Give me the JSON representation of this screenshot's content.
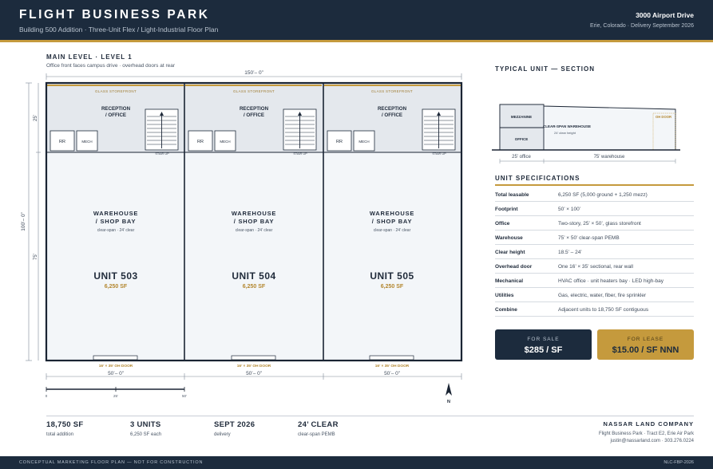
{
  "header": {
    "title": "FLIGHT BUSINESS PARK",
    "subtitle": "Building 500 Addition · Three-Unit Flex / Light-Industrial Floor Plan",
    "address": "3000 Airport Drive",
    "location": "Erie, Colorado · Delivery September 2026"
  },
  "plan": {
    "title": "MAIN LEVEL · LEVEL 1",
    "subtitle": "Office front faces campus drive · overhead doors at rear",
    "overall_width": "150’– 0”",
    "overall_depth": "100’– 0”",
    "office_depth": "25’",
    "warehouse_depth": "75’",
    "units": [
      {
        "storefront": "GLASS STOREFRONT",
        "reception": [
          "RECEPTION",
          "/ OFFICE"
        ],
        "rr": "RR",
        "mech": "MECH",
        "stair": "STAIR UP",
        "warehouse": [
          "WAREHOUSE",
          "/ SHOP BAY"
        ],
        "clear": "clear-span · 24’ clear",
        "unit_name": "UNIT 503",
        "unit_sf": "6,250 SF",
        "door": "16’ × 35’ OH DOOR",
        "width": "50’– 0”"
      },
      {
        "storefront": "GLASS STOREFRONT",
        "reception": [
          "RECEPTION",
          "/ OFFICE"
        ],
        "rr": "RR",
        "mech": "MECH",
        "stair": "STAIR UP",
        "warehouse": [
          "WAREHOUSE",
          "/ SHOP BAY"
        ],
        "clear": "clear-span · 24’ clear",
        "unit_name": "UNIT 504",
        "unit_sf": "6,250 SF",
        "door": "16’ × 35’ OH DOOR",
        "width": "50’– 0”"
      },
      {
        "storefront": "GLASS STOREFRONT",
        "reception": [
          "RECEPTION",
          "/ OFFICE"
        ],
        "rr": "RR",
        "mech": "MECH",
        "stair": "STAIR UP",
        "warehouse": [
          "WAREHOUSE",
          "/ SHOP BAY"
        ],
        "clear": "clear-span · 24’ clear",
        "unit_name": "UNIT 505",
        "unit_sf": "6,250 SF",
        "door": "16’ × 35’ OH DOOR",
        "width": "50’– 0”"
      }
    ],
    "scale_ticks": [
      "0",
      "25’",
      "50’"
    ],
    "north": "N"
  },
  "section": {
    "title": "TYPICAL UNIT — SECTION",
    "mezzanine": "MEZZANINE",
    "office": "OFFICE",
    "warehouse": "CLEAR-SPAN WAREHOUSE",
    "clear_height": "24’ clear height",
    "oh_door": "OH DOOR",
    "office_dim": "25’ office",
    "warehouse_dim": "75’ warehouse"
  },
  "specs": {
    "title": "UNIT SPECIFICATIONS",
    "rows": [
      {
        "label": "Total leasable",
        "value": "6,250 SF (5,000 ground + 1,250 mezz)"
      },
      {
        "label": "Footprint",
        "value": "50’ × 100’"
      },
      {
        "label": "Office",
        "value": "Two-story, 25’ × 50’, glass storefront"
      },
      {
        "label": "Warehouse",
        "value": "75’ × 50’ clear-span PEMB"
      },
      {
        "label": "Clear height",
        "value": "18.5’ – 24’"
      },
      {
        "label": "Overhead door",
        "value": "One 16’ × 35’ sectional, rear wall"
      },
      {
        "label": "Mechanical",
        "value": "HVAC office · unit heaters bay · LED high-bay"
      },
      {
        "label": "Utilities",
        "value": "Gas, electric, water, fiber, fire sprinkler"
      },
      {
        "label": "Combine",
        "value": "Adjacent units to 18,750 SF contiguous"
      }
    ]
  },
  "pricing": {
    "sale_caption": "FOR SALE",
    "sale_value": "$285 / SF",
    "lease_caption": "FOR LEASE",
    "lease_value": "$15.00 / SF NNN"
  },
  "stats": [
    {
      "num": "18,750 SF",
      "label": "total addition"
    },
    {
      "num": "3 UNITS",
      "label": "6,250 SF each"
    },
    {
      "num": "SEPT 2026",
      "label": "delivery"
    },
    {
      "num": "24’ CLEAR",
      "label": "clear-span PEMB"
    }
  ],
  "company": {
    "name": "NASSAR LAND COMPANY",
    "line1": "Flight Business Park · Tract E2, Erie Air Park",
    "line2": "justin@nassarland.com · 303.276.0224"
  },
  "footer": {
    "left": "CONCEPTUAL MARKETING FLOOR PLAN — NOT FOR CONSTRUCTION",
    "right": "NLC-FBP-2026"
  },
  "colors": {
    "navy": "#1c2b3d",
    "gold": "#c59a3d",
    "office_fill": "#e4e8ed",
    "warehouse_fill": "#f3f6f9"
  }
}
